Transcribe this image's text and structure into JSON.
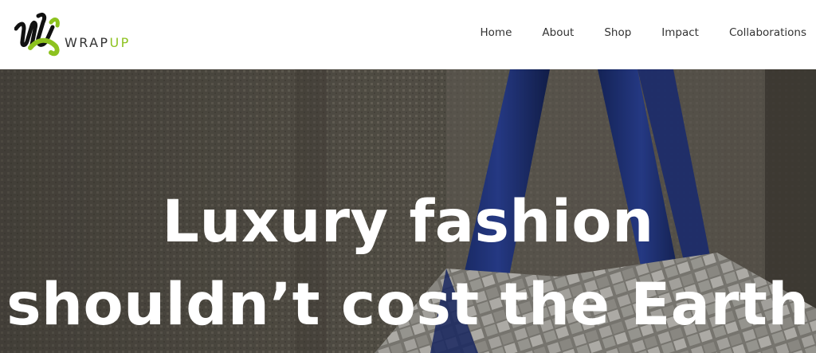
{
  "brand": {
    "wrap": "WRAP",
    "up": "UP",
    "accent_color": "#8dc21f"
  },
  "nav": {
    "items": [
      {
        "label": "Home"
      },
      {
        "label": "About"
      },
      {
        "label": "Shop"
      },
      {
        "label": "Impact"
      },
      {
        "label": "Collaborations"
      }
    ]
  },
  "hero": {
    "title": "Luxury fashion shouldn’t cost the Earth"
  }
}
